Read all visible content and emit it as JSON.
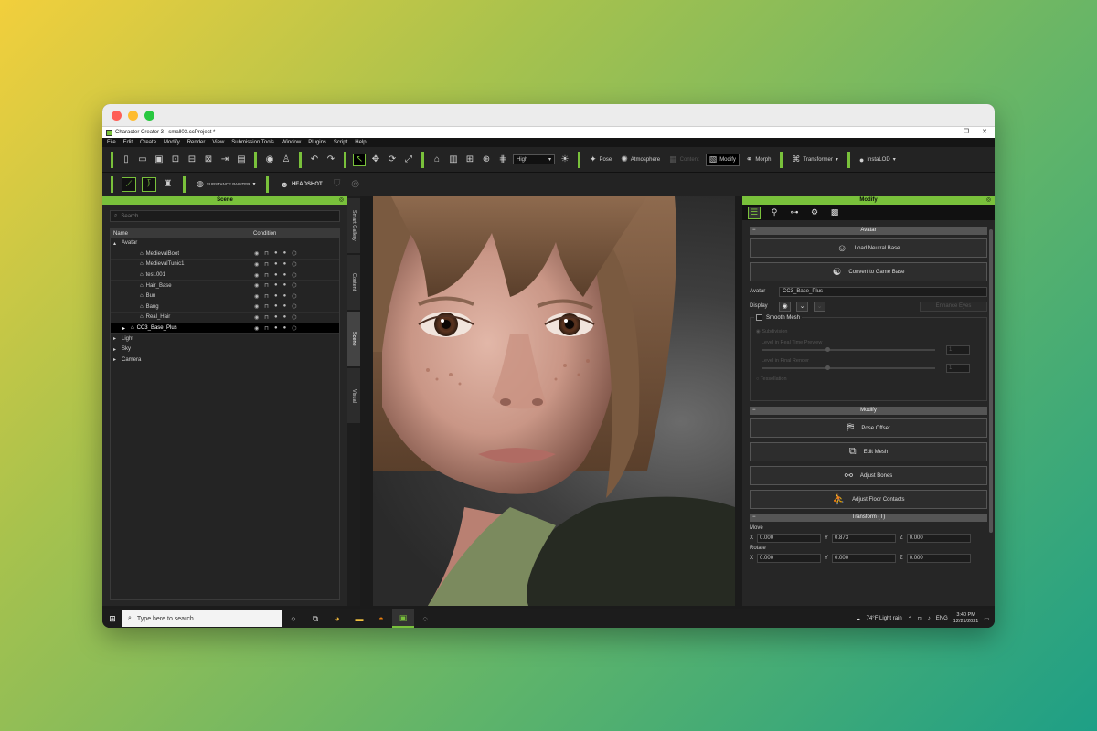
{
  "window": {
    "title": "Character Creator 3 - small03.ccProject *",
    "controls": [
      "–",
      "❐",
      "✕"
    ]
  },
  "menu": [
    "File",
    "Edit",
    "Create",
    "Modify",
    "Render",
    "View",
    "Submission Tools",
    "Window",
    "Plugins",
    "Script",
    "Help"
  ],
  "toolbar": {
    "quality": "High",
    "pose_label": "Pose",
    "atmosphere_label": "Atmosphere",
    "content_label": "Content",
    "modify_label": "Modify",
    "morph_label": "Morph",
    "transformer_label": "Transformer",
    "instalod_label": "InstaLOD",
    "substance_label": "SUBSTANCE PAINTER",
    "headshot_label": "HEADSHOT"
  },
  "scene": {
    "header": "Scene",
    "search_placeholder": "Search",
    "columns": [
      "Name",
      "Condition"
    ],
    "rows": [
      {
        "label": "Avatar",
        "indent": 0,
        "expand": "▴",
        "selected": false
      },
      {
        "label": "MedievalBoot",
        "indent": 2,
        "expand": "",
        "selected": false
      },
      {
        "label": "MedievalTunic1",
        "indent": 2,
        "expand": "",
        "selected": false
      },
      {
        "label": "test.001",
        "indent": 2,
        "expand": "",
        "selected": false
      },
      {
        "label": "Hair_Base",
        "indent": 2,
        "expand": "",
        "selected": false
      },
      {
        "label": "Bun",
        "indent": 2,
        "expand": "",
        "selected": false
      },
      {
        "label": "Bang",
        "indent": 2,
        "expand": "",
        "selected": false
      },
      {
        "label": "Real_Hair",
        "indent": 2,
        "expand": "",
        "selected": false
      },
      {
        "label": "CC3_Base_Plus",
        "indent": 1,
        "expand": "▸",
        "selected": true
      },
      {
        "label": "Light",
        "indent": 0,
        "expand": "▸",
        "selected": false
      },
      {
        "label": "Sky",
        "indent": 0,
        "expand": "▸",
        "selected": false
      },
      {
        "label": "Camera",
        "indent": 0,
        "expand": "▸",
        "selected": false
      }
    ]
  },
  "side_tabs": [
    "Smart Gallery",
    "Content",
    "Scene",
    "Visual"
  ],
  "modify": {
    "header": "Modify",
    "avatar_section": "Avatar",
    "load_neutral": "Load Neutral Base",
    "convert_game": "Convert to Game Base",
    "avatar_label": "Avatar",
    "avatar_value": "CC3_Base_Plus",
    "display_label": "Display",
    "enhance_eyes": "Enhance Eyes",
    "smooth_mesh": "Smooth Mesh",
    "subdivision": "Subdivision",
    "level_realtime": "Level in Real Time Preview",
    "level_render": "Level in Final Render",
    "level_val": "1",
    "tessellation": "Tessellation",
    "modify_section": "Modify",
    "pose_offset": "Pose Offset",
    "edit_mesh": "Edit Mesh",
    "adjust_bones": "Adjust Bones",
    "adjust_floor": "Adjust Floor Contacts",
    "transform_section": "Transform  (T)",
    "move_label": "Move",
    "rotate_label": "Rotate",
    "move": {
      "x": "0.000",
      "y": "0.873",
      "z": "0.000"
    },
    "rotate": {
      "x": "0.000",
      "y": "0.000",
      "z": "0.000"
    }
  },
  "taskbar": {
    "search_placeholder": "Type here to search",
    "weather": "74°F  Light rain",
    "lang": "ENG",
    "time": "3:40 PM",
    "date": "12/21/2021"
  },
  "colors": {
    "accent": "#79c13b",
    "panel": "#262626",
    "toolbar": "#232323"
  }
}
